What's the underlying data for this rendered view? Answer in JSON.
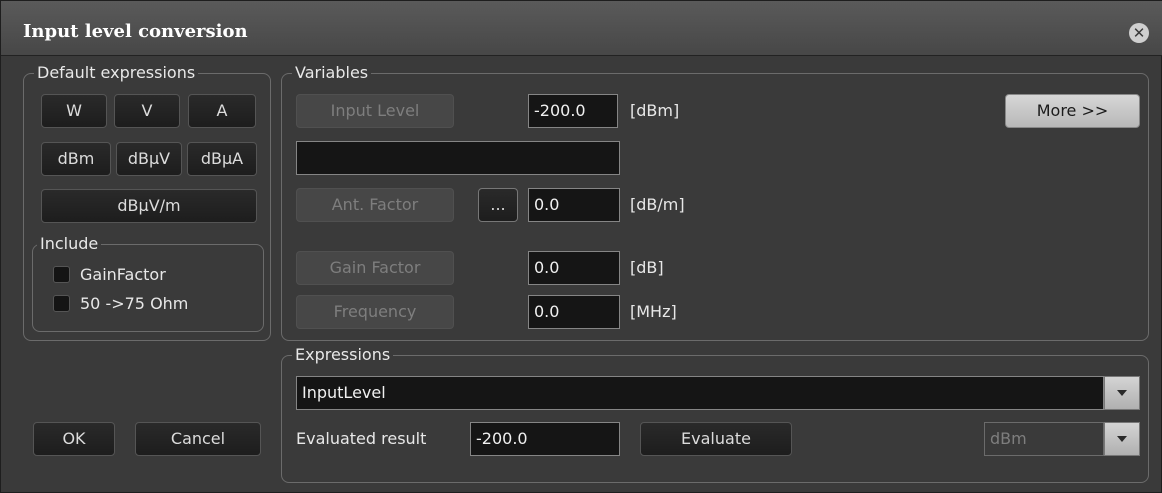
{
  "window": {
    "title": "Input level conversion"
  },
  "default_expressions": {
    "legend": "Default expressions",
    "buttons": [
      "W",
      "V",
      "A",
      "dBm",
      "dBµV",
      "dBµA",
      "dBµV/m"
    ]
  },
  "include": {
    "legend": "Include",
    "options": [
      {
        "label": "GainFactor",
        "checked": false
      },
      {
        "label": "50 ->75 Ohm",
        "checked": false
      }
    ]
  },
  "variables": {
    "legend": "Variables",
    "more_label": "More >>",
    "input_level": {
      "label": "Input Level",
      "value": "-200.0",
      "unit": "[dBm]"
    },
    "text_field": "",
    "ant_factor": {
      "label": "Ant. Factor",
      "browse_label": "...",
      "value": "0.0",
      "unit": "[dB/m]"
    },
    "gain_factor": {
      "label": "Gain Factor",
      "value": "0.0",
      "unit": "[dB]"
    },
    "frequency": {
      "label": "Frequency",
      "value": "0.0",
      "unit": "[MHz]"
    }
  },
  "expressions": {
    "legend": "Expressions",
    "selected": "InputLevel",
    "evaluated_label": "Evaluated result",
    "evaluated_value": "-200.0",
    "evaluate_label": "Evaluate",
    "unit_selected": "dBm"
  },
  "footer": {
    "ok_label": "OK",
    "cancel_label": "Cancel"
  }
}
